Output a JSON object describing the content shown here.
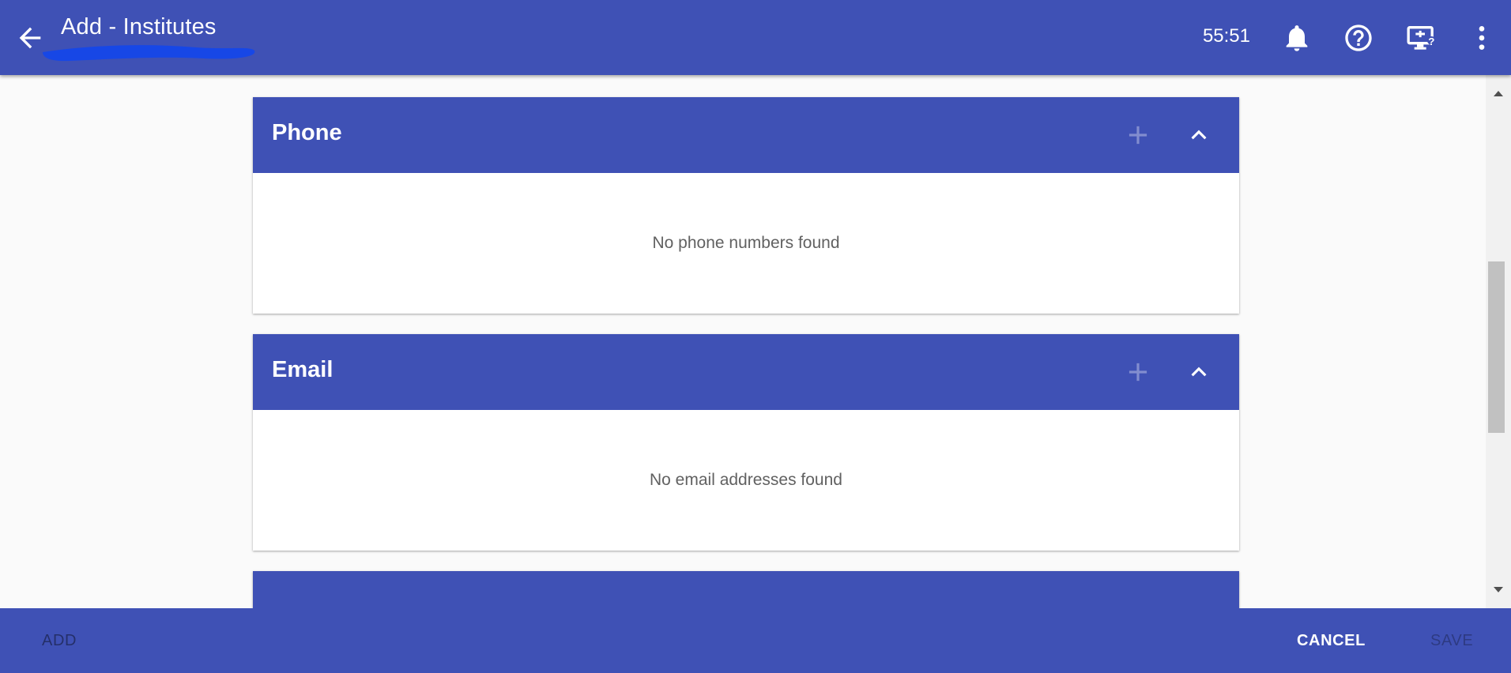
{
  "header": {
    "title": "Add - Institutes",
    "timer": "55:51",
    "back_icon": "arrow-back-icon",
    "icons": [
      "bell-icon",
      "help-icon",
      "screen-help-icon",
      "more-vert-icon"
    ],
    "color": "#3f51b5"
  },
  "sections": [
    {
      "title": "Phone",
      "empty_text": "No phone numbers found",
      "expanded": true
    },
    {
      "title": "Email",
      "empty_text": "No email addresses found",
      "expanded": true
    }
  ],
  "footer": {
    "add_label": "ADD",
    "cancel_label": "CANCEL",
    "save_label": "SAVE"
  }
}
